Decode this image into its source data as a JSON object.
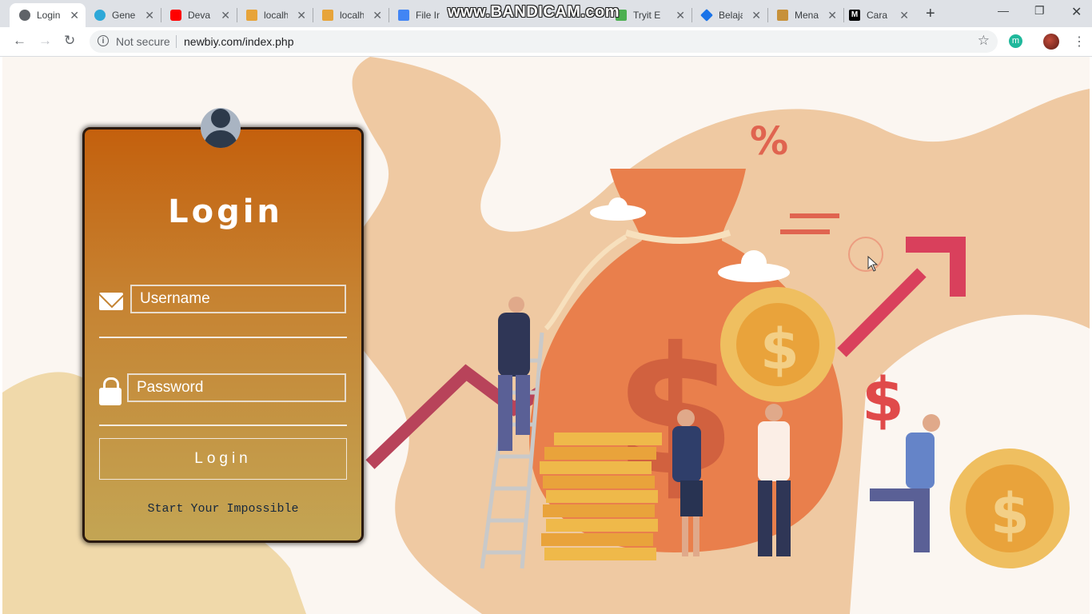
{
  "browser": {
    "tabs": [
      {
        "label": "Login",
        "icon": "globe-icon",
        "color": "#5f6368"
      },
      {
        "label": "Gener",
        "icon": "app-icon",
        "color": "#2da8d8"
      },
      {
        "label": "Deva",
        "icon": "youtube-icon",
        "color": "#ff0000"
      },
      {
        "label": "localh",
        "icon": "phpmyadmin-icon",
        "color": "#e7a43a"
      },
      {
        "label": "localh",
        "icon": "phpmyadmin-icon",
        "color": "#e7a43a"
      },
      {
        "label": "File In",
        "icon": "flag-icon",
        "color": "#4285f4"
      },
      {
        "label": "Tryit E",
        "icon": "w3-icon",
        "color": "#4caf50"
      },
      {
        "label": "Belaja",
        "icon": "code-icon",
        "color": "#1a73e8"
      },
      {
        "label": "Mena",
        "icon": "comic-icon",
        "color": "#c7913a"
      },
      {
        "label": "Cara",
        "icon": "medium-icon",
        "color": "#000000"
      }
    ],
    "watermark": "www.BANDICAM.com",
    "security": "Not secure",
    "url": "newbiy.com/index.php",
    "extension_letter": "m"
  },
  "login": {
    "title": "Login",
    "username_placeholder": "Username",
    "password_placeholder": "Password",
    "button": "Login",
    "tagline": "Start Your Impossible"
  },
  "illustration": {
    "percent_sign": "%",
    "dollar_sign": "$"
  },
  "colors": {
    "card_top": "#c4600d",
    "card_bottom": "#c3a554",
    "accent_red": "#d9405c",
    "coin": "#e9a33b"
  }
}
